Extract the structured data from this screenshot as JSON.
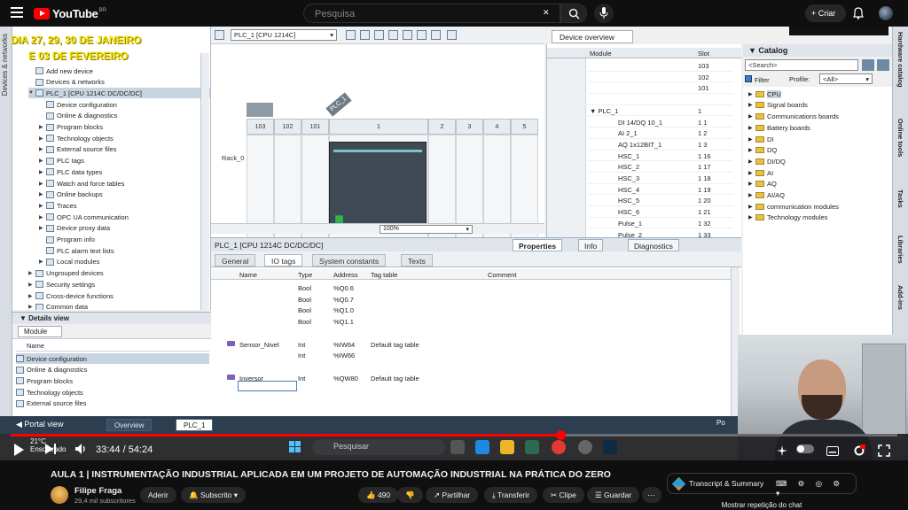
{
  "youtube": {
    "logo": "YouTube",
    "logo_sup": "BR",
    "search_placeholder": "Pesquisa",
    "create_label": "Criar"
  },
  "tia": {
    "left_vtab": "Devices & networks",
    "overlay_line1": "DIA 27, 29, 30 DE JANEIRO",
    "overlay_line2": "E 03 DE FEVEREIRO",
    "tree_items": [
      {
        "label": "Add new device",
        "indent": 1,
        "exp": ""
      },
      {
        "label": "Devices & networks",
        "indent": 1,
        "exp": ""
      },
      {
        "label": "PLC_1 [CPU 1214C DC/DC/DC]",
        "indent": 1,
        "exp": "▼",
        "selected": true
      },
      {
        "label": "Device configuration",
        "indent": 2,
        "exp": ""
      },
      {
        "label": "Online & diagnostics",
        "indent": 2,
        "exp": ""
      },
      {
        "label": "Program blocks",
        "indent": 2,
        "exp": "▶"
      },
      {
        "label": "Technology objects",
        "indent": 2,
        "exp": "▶"
      },
      {
        "label": "External source files",
        "indent": 2,
        "exp": "▶"
      },
      {
        "label": "PLC tags",
        "indent": 2,
        "exp": "▶"
      },
      {
        "label": "PLC data types",
        "indent": 2,
        "exp": "▶"
      },
      {
        "label": "Watch and force tables",
        "indent": 2,
        "exp": "▶"
      },
      {
        "label": "Online backups",
        "indent": 2,
        "exp": "▶"
      },
      {
        "label": "Traces",
        "indent": 2,
        "exp": "▶"
      },
      {
        "label": "OPC UA communication",
        "indent": 2,
        "exp": "▶"
      },
      {
        "label": "Device proxy data",
        "indent": 2,
        "exp": "▶"
      },
      {
        "label": "Program info",
        "indent": 2,
        "exp": ""
      },
      {
        "label": "PLC alarm text lists",
        "indent": 2,
        "exp": ""
      },
      {
        "label": "Local modules",
        "indent": 2,
        "exp": "▶"
      },
      {
        "label": "Ungrouped devices",
        "indent": 1,
        "exp": "▶"
      },
      {
        "label": "Security settings",
        "indent": 1,
        "exp": "▶"
      },
      {
        "label": "Cross-device functions",
        "indent": 1,
        "exp": "▶"
      },
      {
        "label": "Common data",
        "indent": 1,
        "exp": "▶"
      }
    ],
    "details_view": "Details view",
    "details_tab": "Module",
    "details_col": "Name",
    "details_items": [
      "Device configuration",
      "Online & diagnostics",
      "Program blocks",
      "Technology objects",
      "External source files"
    ],
    "device_select": "PLC_1 [CPU 1214C]",
    "rack_slots": [
      "103",
      "102",
      "101",
      "1",
      "2",
      "3",
      "4",
      "5"
    ],
    "rack_label": "Rack_0",
    "plc_tag": "PLC_1",
    "zoom": "100%",
    "overview_tab": "Device overview",
    "overview_col_module": "Module",
    "overview_col_slot": "Slot",
    "overview_rows": [
      {
        "module": "",
        "slot": "103"
      },
      {
        "module": "",
        "slot": "102"
      },
      {
        "module": "",
        "slot": "101"
      },
      {
        "module": "",
        "slot": ""
      },
      {
        "module": "▼  PLC_1",
        "slot": "1"
      },
      {
        "module": "DI 14/DQ 10_1",
        "slot": "1 1"
      },
      {
        "module": "AI 2_1",
        "slot": "1 2"
      },
      {
        "module": "AQ 1x12BIT_1",
        "slot": "1 3"
      },
      {
        "module": "HSC_1",
        "slot": "1 16"
      },
      {
        "module": "HSC_2",
        "slot": "1 17"
      },
      {
        "module": "HSC_3",
        "slot": "1 18"
      },
      {
        "module": "HSC_4",
        "slot": "1 19"
      },
      {
        "module": "HSC_5",
        "slot": "1 20"
      },
      {
        "module": "HSC_6",
        "slot": "1 21"
      },
      {
        "module": "Pulse_1",
        "slot": "1 32"
      },
      {
        "module": "Pulse_2",
        "slot": "1 33"
      }
    ],
    "prop_title": "PLC_1 [CPU 1214C DC/DC/DC]",
    "prop_tabs": [
      "Properties",
      "Info",
      "Diagnostics"
    ],
    "sub_tabs": [
      "General",
      "IO tags",
      "System constants",
      "Texts"
    ],
    "tag_headers": [
      "Name",
      "Type",
      "Address",
      "Tag table",
      "Comment"
    ],
    "tag_rows": [
      {
        "name": "",
        "type": "Bool",
        "addr": "%Q0.6",
        "table": "",
        "icon": false
      },
      {
        "name": "",
        "type": "Bool",
        "addr": "%Q0.7",
        "table": "",
        "icon": false
      },
      {
        "name": "",
        "type": "Bool",
        "addr": "%Q1.0",
        "table": "",
        "icon": false
      },
      {
        "name": "",
        "type": "Bool",
        "addr": "%Q1.1",
        "table": "",
        "icon": false
      },
      {
        "name": "",
        "type": "",
        "addr": "",
        "table": "",
        "icon": false
      },
      {
        "name": "Sensor_Nivel",
        "type": "Int",
        "addr": "%IW64",
        "table": "Default tag table",
        "icon": true
      },
      {
        "name": "",
        "type": "Int",
        "addr": "%IW66",
        "table": "",
        "icon": false
      },
      {
        "name": "",
        "type": "",
        "addr": "",
        "table": "",
        "icon": false
      },
      {
        "name": "Inversor",
        "type": "Int",
        "addr": "%QW80",
        "table": "Default tag table",
        "icon": true
      }
    ],
    "catalog_title": "Catalog",
    "catalog_search": "<Search>",
    "catalog_filter": "Filter",
    "catalog_profile": "Profile:",
    "catalog_profile_value": "<All>",
    "catalog_items": [
      {
        "label": "CPU",
        "sel": true
      },
      {
        "label": "Signal boards",
        "sel": false
      },
      {
        "label": "Communications boards",
        "sel": false
      },
      {
        "label": "Battery boards",
        "sel": false
      },
      {
        "label": "DI",
        "sel": false
      },
      {
        "label": "DQ",
        "sel": false
      },
      {
        "label": "DI/DQ",
        "sel": false
      },
      {
        "label": "AI",
        "sel": false
      },
      {
        "label": "AQ",
        "sel": false
      },
      {
        "label": "AI/AQ",
        "sel": false
      },
      {
        "label": "communication modules",
        "sel": false
      },
      {
        "label": "Technology modules",
        "sel": false
      }
    ],
    "right_vtabs": [
      "Hardware catalog",
      "Online tools",
      "Tasks",
      "Libraries",
      "Add-ins"
    ],
    "portal_view": "Portal view",
    "portal_tabs": [
      "Overview",
      "PLC_1"
    ],
    "portal_right": "Po"
  },
  "taskbar": {
    "temp": "21°C",
    "weather": "Ensolarado",
    "search": "Pesquisar"
  },
  "player": {
    "time": "33:44 / 54:24",
    "progress": 0.62
  },
  "video_info": {
    "title": "AULA 1 | INSTRUMENTAÇÃO INDUSTRIAL APLICADA EM UM PROJETO DE AUTOMAÇÃO INDUSTRIAL NA PRÁTICA DO ZERO",
    "channel": "Filipe Fraga",
    "subs": "29,4 mil subscritores",
    "join": "Aderir",
    "subscribed": "Subscrito",
    "likes": "490",
    "share": "Partilhar",
    "download": "Transferir",
    "clip": "Clipe",
    "save": "Guardar",
    "transcript": "Transcript & Summary",
    "chat_replay": "Mostrar repetição do chat"
  },
  "colors": {
    "accent": "#ff0000",
    "overlay": "#f5e400",
    "tia_portal_bar": "#2c3e50"
  }
}
